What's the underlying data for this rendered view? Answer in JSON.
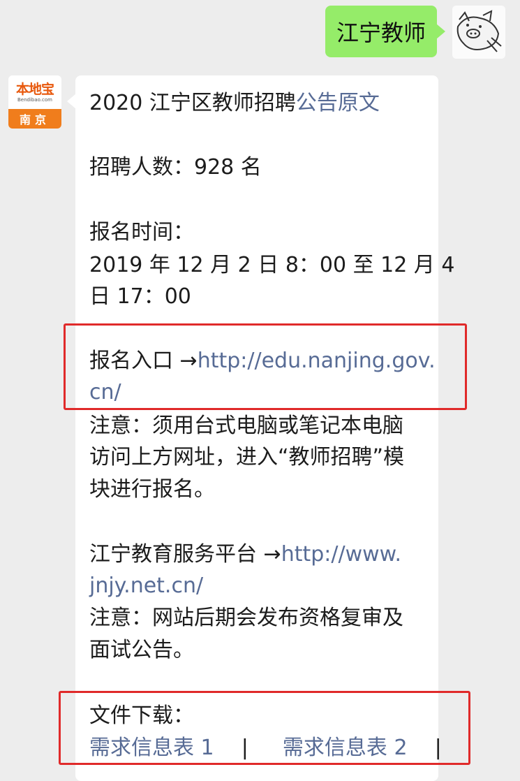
{
  "chat": {
    "sent": {
      "text": "江宁教师"
    },
    "sender": {
      "logo_main": "本地宝",
      "logo_sub": "Bendibao.com",
      "logo_city": "南京"
    },
    "message": {
      "title_prefix": "2020 江宁区教师招聘",
      "title_link": "公告原文",
      "count_line": "招聘人数：928 名",
      "time_label": "报名时间：",
      "time_line_1": "2019 年 12 月 2 日 8：00 至 12 月 4",
      "time_line_2": "日 17：00",
      "entry_label": "报名入口 →",
      "entry_link_1": "http://edu.nanjing.gov.",
      "entry_link_2": "cn/",
      "note1_line_1": "注意：须用台式电脑或笔记本电脑",
      "note1_line_2": "访问上方网址，进入“教师招聘”模",
      "note1_line_3": "块进行报名。",
      "platform_label": "江宁教育服务平台 →",
      "platform_link_1": "http://www.",
      "platform_link_2": "jnjy.net.cn/",
      "note2_line_1": "注意：网站后期会发布资格复审及",
      "note2_line_2": "面试公告。",
      "download_label": "文件下载：",
      "download_link_1": "需求信息表 1",
      "separator": "|",
      "download_link_2": "需求信息表 2"
    }
  },
  "colors": {
    "background": "#ededed",
    "sent_bubble": "#95ec69",
    "link": "#576b95",
    "highlight": "#e02a2a",
    "brand_orange": "#f07d1c"
  }
}
